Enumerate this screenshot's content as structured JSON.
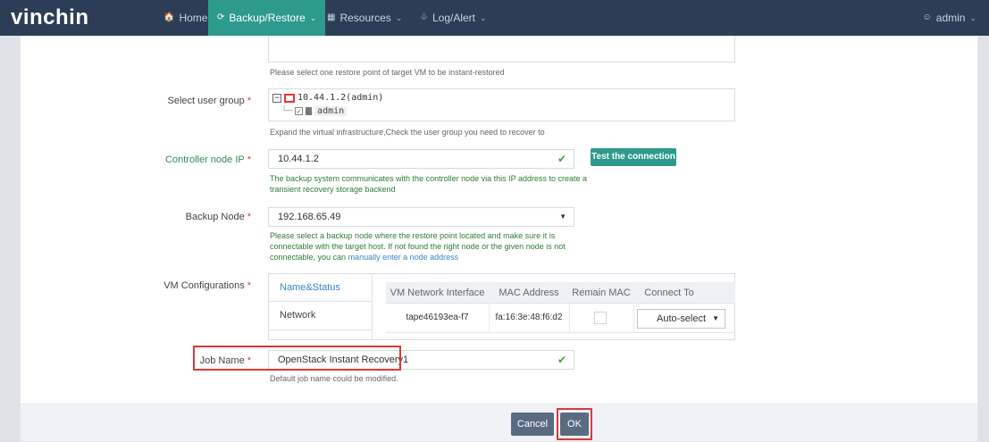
{
  "nav": {
    "logo": "vinchin",
    "home": "Home",
    "backup_restore": "Backup/Restore",
    "resources": "Resources",
    "log_alert": "Log/Alert",
    "user": "admin",
    "home_icon": "home-icon",
    "backup_icon": "refresh-icon",
    "resources_icon": "grid-icon",
    "log_icon": "bell-icon",
    "user_icon": "user-icon"
  },
  "restore_point": {
    "hint": "Please select one restore point of target VM to be instant-restored"
  },
  "user_group": {
    "label": "Select user group",
    "required": "*",
    "root": "10.44.1.2(admin)",
    "child": "admin",
    "hint": "Expand the virtual infrastructure,Check the user group you need to recover to"
  },
  "controller_ip": {
    "label": "Controller node IP",
    "required": "*",
    "value": "10.44.1.2",
    "test_button": "Test the connection",
    "hint_line1": "The backup system communicates with the controller node via this IP address to create a",
    "hint_line2": "transient recovery storage backend"
  },
  "backup_node": {
    "label": "Backup Node",
    "required": "*",
    "value": "192.168.65.49",
    "hint_line1": "Please select a backup node where the restore point located and make sure it is",
    "hint_line2": "connectable with the target host. If not found the right node or the given node is not",
    "hint_line3_prefix": "connectable, you can ",
    "hint_link": "manually enter a node address"
  },
  "vm_config": {
    "label": "VM Configurations",
    "required": "*",
    "tabs": [
      "Name&Status",
      "Network"
    ],
    "columns": [
      "VM Network Interface",
      "MAC Address",
      "Remain MAC",
      "Connect To"
    ],
    "rows": [
      {
        "interface": "tape46193ea-f7",
        "mac": "fa:16:3e:48:f6:d2",
        "remain_mac": false,
        "connect_to": "Auto-select"
      }
    ]
  },
  "job_name": {
    "label": "Job Name",
    "required": "*",
    "value": "OpenStack Instant Recovery1",
    "hint": "Default job name could be modified."
  },
  "footer": {
    "cancel": "Cancel",
    "ok": "OK"
  },
  "colors": {
    "nav_bg": "#2b3e55",
    "accent": "#2e9a8e",
    "highlight": "#d93a3a"
  }
}
